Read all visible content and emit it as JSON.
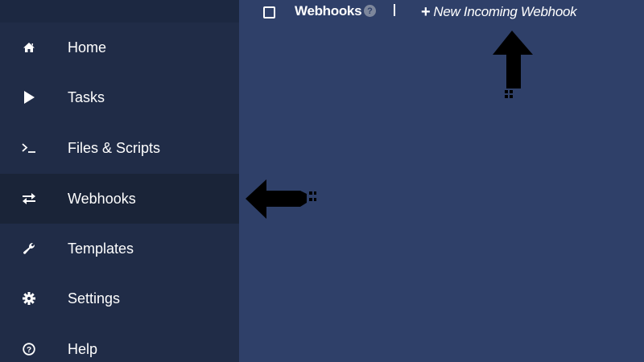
{
  "sidebar": {
    "items": [
      {
        "label": "Home",
        "icon": "home-icon"
      },
      {
        "label": "Tasks",
        "icon": "play-icon"
      },
      {
        "label": "Files & Scripts",
        "icon": "terminal-icon"
      },
      {
        "label": "Webhooks",
        "icon": "exchange-icon",
        "active": true
      },
      {
        "label": "Templates",
        "icon": "wrench-icon"
      },
      {
        "label": "Settings",
        "icon": "gear-icon"
      },
      {
        "label": "Help",
        "icon": "question-circle-icon"
      }
    ]
  },
  "topbar": {
    "title": "Webhooks",
    "help_glyph": "?",
    "new_webhook_icon": "+",
    "new_webhook_label": "New Incoming Webhook"
  },
  "colors": {
    "main_bg": "#2f4069",
    "sidebar_bg": "#202c47",
    "sidebar_active_bg": "#1a2438",
    "text": "#ffffff"
  }
}
